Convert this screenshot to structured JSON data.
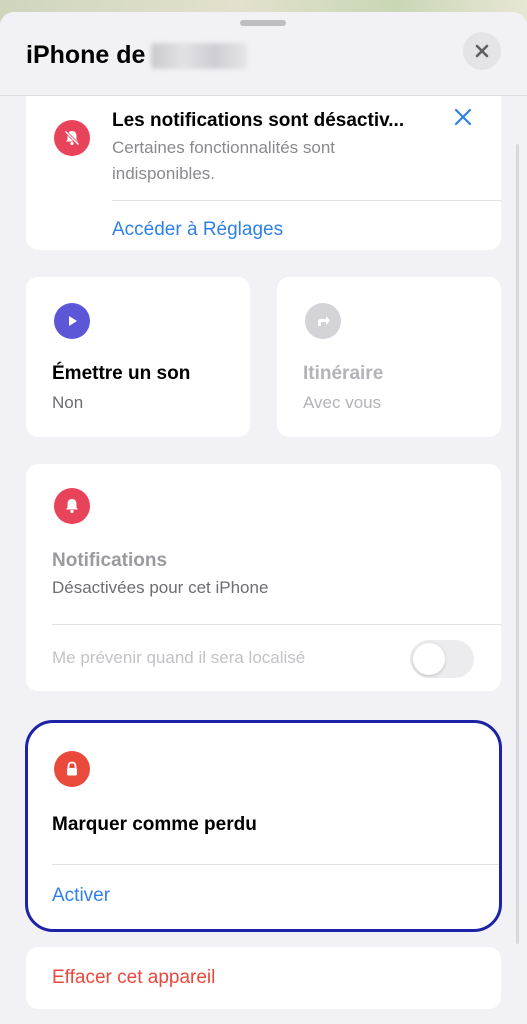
{
  "header": {
    "title": "iPhone de",
    "close_icon": "close-icon"
  },
  "banner": {
    "title": "Les notifications sont désactiv...",
    "subtitle_line1": "Certaines fonctionnalités sont",
    "subtitle_line2": "indisponibles.",
    "link": "Accéder à Réglages",
    "icon": "bell-slash-icon",
    "dismiss_icon": "x-icon",
    "icon_color": "#e8435a"
  },
  "play_sound": {
    "title": "Émettre un son",
    "subtitle": "Non",
    "icon": "play-icon",
    "icon_color": "#5b57d6"
  },
  "directions": {
    "title": "Itinéraire",
    "subtitle": "Avec vous",
    "icon": "directions-arrow-icon",
    "icon_color": "#d3d3d8"
  },
  "notifications": {
    "title": "Notifications",
    "subtitle": "Désactivées pour cet iPhone",
    "toggle_label": "Me prévenir quand il sera localisé",
    "toggle_on": false,
    "icon": "bell-icon",
    "icon_color": "#e8435a"
  },
  "lost_mode": {
    "title": "Marquer comme perdu",
    "link": "Activer",
    "icon": "lock-icon",
    "icon_color": "#ea4a3c"
  },
  "erase": {
    "label": "Effacer cet appareil",
    "color": "#e9483b"
  }
}
